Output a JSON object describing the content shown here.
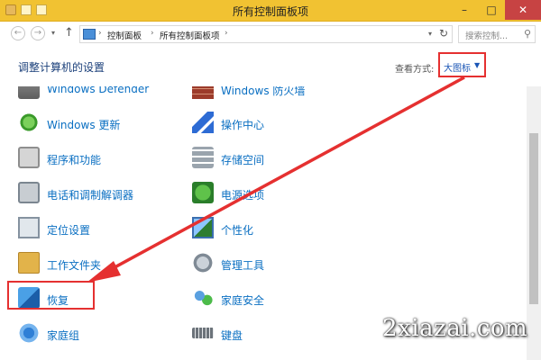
{
  "window": {
    "title": "所有控制面板项"
  },
  "addressbar": {
    "crumbs": [
      "控制面板",
      "所有控制面板项"
    ],
    "search_placeholder": "搜索控制..."
  },
  "header": {
    "title": "调整计算机的设置",
    "view_by_label": "查看方式:",
    "view_by_value": "大图标"
  },
  "items": {
    "windows_defender": "Windows Defender",
    "windows_firewall": "Windows 防火墙",
    "windows_update": "Windows 更新",
    "action_center": "操作中心",
    "programs": "程序和功能",
    "storage_spaces": "存储空间",
    "phone_modem": "电话和调制解调器",
    "power_options": "电源选项",
    "location": "定位设置",
    "personalization": "个性化",
    "work_folders": "工作文件夹",
    "admin_tools": "管理工具",
    "recovery": "恢复",
    "family_safety": "家庭安全",
    "homegroup": "家庭组",
    "keyboard": "键盘"
  },
  "watermark": "2xiazai.com",
  "colors": {
    "annotation": "#e53030",
    "link": "#0a6fc2",
    "titlebar": "#f1c232"
  }
}
